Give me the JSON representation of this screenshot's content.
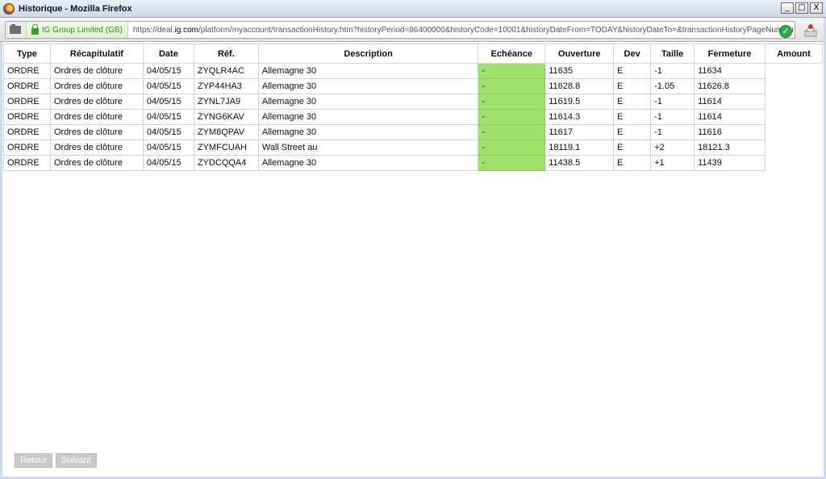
{
  "window": {
    "title": "Historique - Mozilla Firefox",
    "minimize": "_",
    "maximize": "□",
    "close": "X"
  },
  "urlbar": {
    "identity": "IG Group Limited (GB)",
    "url_prefix": "https://deal.",
    "url_domain": "ig.com",
    "url_rest": "/platform/myaccount/transactionHistory.htm?historyPeriod=86400000&historyCode=10001&historyDateFrom=TODAY&historyDateTo=&transactionHistoryPageNumber="
  },
  "table": {
    "headers": [
      "Type",
      "Récapitulatif",
      "Date",
      "Réf.",
      "Description",
      "Echéance",
      "Ouverture",
      "Dev",
      "Taille",
      "Fermeture",
      "Amount"
    ],
    "rows": [
      [
        "ORDRE",
        "Ordres de clôture",
        "04/05/15",
        "ZYQLR4AC",
        "Allemagne 30",
        "-",
        "11635",
        "E",
        "-1",
        "11634",
        ""
      ],
      [
        "ORDRE",
        "Ordres de clôture",
        "04/05/15",
        "ZYP44HA3",
        "Allemagne 30",
        "-",
        "11628.8",
        "E",
        "-1.05",
        "11626.8",
        ""
      ],
      [
        "ORDRE",
        "Ordres de clôture",
        "04/05/15",
        "ZYNL7JA9",
        "Allemagne 30",
        "-",
        "11619.5",
        "E",
        "-1",
        "11614",
        ""
      ],
      [
        "ORDRE",
        "Ordres de clôture",
        "04/05/15",
        "ZYNG6KAV",
        "Allemagne 30",
        "-",
        "11614.3",
        "E",
        "-1",
        "11614",
        ""
      ],
      [
        "ORDRE",
        "Ordres de clôture",
        "04/05/15",
        "ZYM8QPAV",
        "Allemagne 30",
        "-",
        "11617",
        "E",
        "-1",
        "11616",
        ""
      ],
      [
        "ORDRE",
        "Ordres de clôture",
        "04/05/15",
        "ZYMFCUAH",
        "Wall Street au",
        "-",
        "18119.1",
        "E",
        "+2",
        "18121.3",
        ""
      ],
      [
        "ORDRE",
        "Ordres de clôture",
        "04/05/15",
        "ZYDCQQA4",
        "Allemagne 30",
        "-",
        "11438.5",
        "E",
        "+1",
        "11439",
        ""
      ]
    ]
  },
  "pagination": {
    "previous": "Retour",
    "next": "Suivant"
  },
  "colors": {
    "echeance_cell": "#9ee26b",
    "identity_text": "#2e8a22"
  }
}
